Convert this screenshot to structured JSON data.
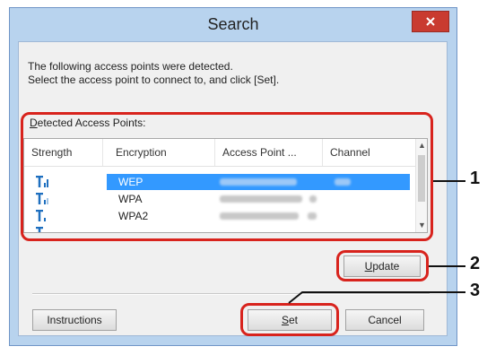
{
  "window": {
    "title": "Search"
  },
  "description": {
    "line1": "The following access points were detected.",
    "line2": "Select the access point to connect to, and click [Set]."
  },
  "group": {
    "label_prefix": "D",
    "label_rest": "etected Access Points:"
  },
  "list": {
    "columns": [
      "Strength",
      "Encryption",
      "Access Point ...",
      "Channel"
    ],
    "rows": [
      {
        "encryption": "WEP",
        "selected": true,
        "strength_icon": "signal-strength-icon"
      },
      {
        "encryption": "WPA",
        "selected": false,
        "strength_icon": "signal-strength-icon"
      },
      {
        "encryption": "WPA2",
        "selected": false,
        "strength_icon": "signal-strength-icon"
      }
    ]
  },
  "buttons": {
    "update_ul": "U",
    "update_rest": "pdate",
    "instructions": "Instructions",
    "set_ul": "S",
    "set_rest": "et",
    "cancel": "Cancel"
  },
  "callouts": [
    "1",
    "2",
    "3"
  ],
  "colors": {
    "title_bar": "#b8d3ee",
    "close_button": "#c93b30",
    "selection": "#3399ff",
    "highlight": "#d8231d",
    "signal_icon": "#1e6fbf"
  }
}
